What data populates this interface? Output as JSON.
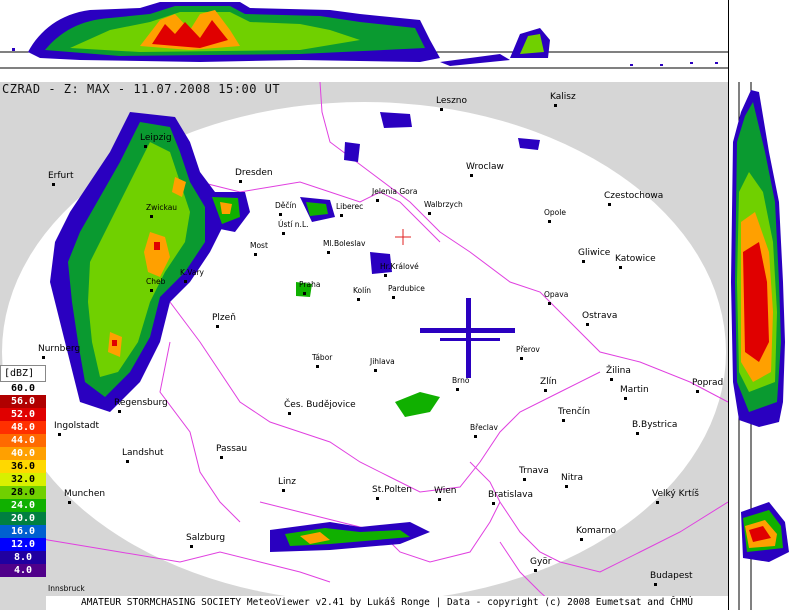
{
  "title": "CZRAD - Z: MAX - 11.07.2008 15:00 UT",
  "footer": "AMATEUR STORMCHASING SOCIETY MeteoViewer v2.41 by Lukáš Ronge | Data - copyright (c) 2008 Eumetsat and ČHMÚ",
  "legend": {
    "header": "[dBZ]",
    "levels": [
      {
        "label": "60.0",
        "color": "#ffffff",
        "text": "#000000"
      },
      {
        "label": "56.0",
        "color": "#b00000",
        "text": "#ffffff"
      },
      {
        "label": "52.0",
        "color": "#e00000",
        "text": "#ffffff"
      },
      {
        "label": "48.0",
        "color": "#ff3000",
        "text": "#ffffff"
      },
      {
        "label": "44.0",
        "color": "#ff6a00",
        "text": "#ffffff"
      },
      {
        "label": "40.0",
        "color": "#ffa000",
        "text": "#ffffff"
      },
      {
        "label": "36.0",
        "color": "#ffd800",
        "text": "#000000"
      },
      {
        "label": "32.0",
        "color": "#d8f000",
        "text": "#000000"
      },
      {
        "label": "28.0",
        "color": "#70d000",
        "text": "#000000"
      },
      {
        "label": "24.0",
        "color": "#10b000",
        "text": "#ffffff"
      },
      {
        "label": "20.0",
        "color": "#008040",
        "text": "#ffffff"
      },
      {
        "label": "16.0",
        "color": "#0060d0",
        "text": "#ffffff"
      },
      {
        "label": "12.0",
        "color": "#0000ff",
        "text": "#ffffff"
      },
      {
        "label": "8.0",
        "color": "#2000a0",
        "text": "#ffffff"
      },
      {
        "label": "4.0",
        "color": "#50008a",
        "text": "#ffffff"
      }
    ]
  },
  "cities": [
    {
      "name": "Leszno"
    },
    {
      "name": "Kalisz"
    },
    {
      "name": "Leipzig"
    },
    {
      "name": "Erfurt"
    },
    {
      "name": "Dresden"
    },
    {
      "name": "Wroclaw"
    },
    {
      "name": "Jelenia Gora"
    },
    {
      "name": "Walbrzych"
    },
    {
      "name": "Liberec"
    },
    {
      "name": "Děčín"
    },
    {
      "name": "Ústí n.L."
    },
    {
      "name": "Zwickau"
    },
    {
      "name": "Most"
    },
    {
      "name": "Ml.Boleslav"
    },
    {
      "name": "Opole"
    },
    {
      "name": "Czestochowa"
    },
    {
      "name": "Gliwice"
    },
    {
      "name": "Katowice"
    },
    {
      "name": "Hr.Králové"
    },
    {
      "name": "K.Vary"
    },
    {
      "name": "Cheb"
    },
    {
      "name": "Praha"
    },
    {
      "name": "Kolín"
    },
    {
      "name": "Pardubice"
    },
    {
      "name": "Opava"
    },
    {
      "name": "Ostrava"
    },
    {
      "name": "Plzeň"
    },
    {
      "name": "Nurnberg"
    },
    {
      "name": "Tábor"
    },
    {
      "name": "Jihlava"
    },
    {
      "name": "Přerov"
    },
    {
      "name": "Žilina"
    },
    {
      "name": "Zlín"
    },
    {
      "name": "Brno"
    },
    {
      "name": "Martin"
    },
    {
      "name": "Poprad"
    },
    {
      "name": "Regensburg"
    },
    {
      "name": "Čes. Budějovice"
    },
    {
      "name": "Trenčín"
    },
    {
      "name": "Ingolstadt"
    },
    {
      "name": "Břeclav"
    },
    {
      "name": "B.Bystrica"
    },
    {
      "name": "Passau"
    },
    {
      "name": "Landshut"
    },
    {
      "name": "Trnava"
    },
    {
      "name": "Nitra"
    },
    {
      "name": "Linz"
    },
    {
      "name": "Munchen"
    },
    {
      "name": "St.Polten"
    },
    {
      "name": "Wien"
    },
    {
      "name": "Bratislava"
    },
    {
      "name": "Velký Krtíš"
    },
    {
      "name": "Komarno"
    },
    {
      "name": "Salzburg"
    },
    {
      "name": "Györ"
    },
    {
      "name": "Budapest"
    },
    {
      "name": "Innsbruck"
    }
  ]
}
